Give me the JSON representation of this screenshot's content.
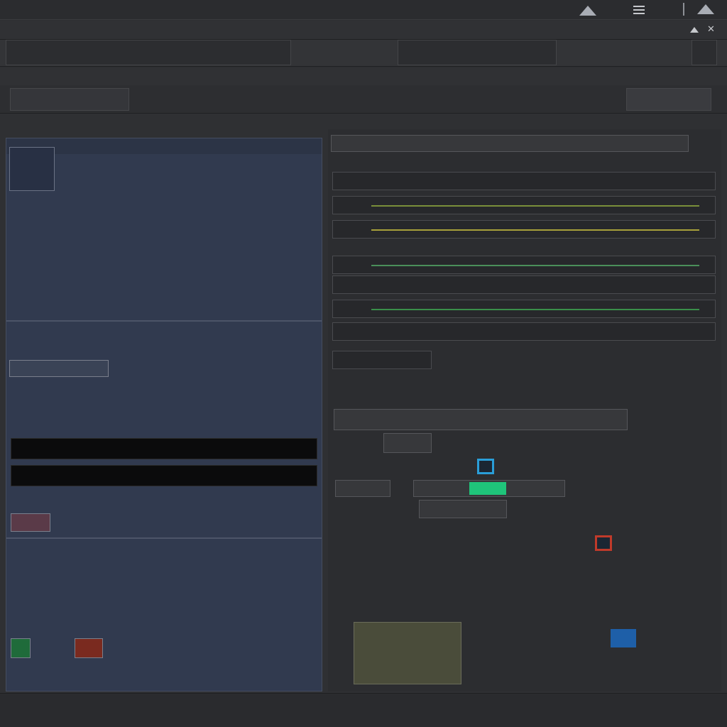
{
  "colors": {
    "app_background": "#2f3033",
    "left_panel": "#313a4f",
    "right_panel": "#2c2d30",
    "accent_green": "#1fc47a",
    "accent_blue": "#2a9ed8"
  },
  "icons": {
    "topbar": [
      "mountain-icon",
      "menu-icon",
      "minimize-icon",
      "maximize-icon"
    ],
    "window_controls": [
      "window-up-icon",
      "close-icon"
    ]
  },
  "topbar": {
    "title": "",
    "counter": ""
  },
  "menubar": {
    "left_text": "",
    "right_text": ""
  },
  "toolbar": {
    "group_1": "",
    "group_2": "",
    "group_3": "",
    "group_4": "",
    "right_text": ""
  },
  "substrip": {
    "text": ""
  },
  "tabs": [
    {
      "label": ""
    },
    {
      "label": ""
    },
    {
      "label": ""
    },
    {
      "label": ""
    },
    {
      "label": ""
    },
    {
      "label": ""
    }
  ],
  "section_bar": {
    "text": ""
  },
  "left_panel": {
    "header": "",
    "rows": [
      "",
      "",
      "",
      "",
      "",
      ""
    ],
    "secondary_rows": [
      "",
      "",
      "",
      "",
      ""
    ],
    "dark_rows": [
      "",
      ""
    ],
    "list_rows": [
      "",
      "",
      "",
      "",
      "",
      "",
      ""
    ],
    "footer": ""
  },
  "right_panel": {
    "header": "",
    "track_labels": [
      "",
      "",
      "",
      "",
      "",
      "",
      "",
      "",
      "",
      ""
    ],
    "chips": [
      "",
      "",
      "",
      "",
      "",
      ""
    ],
    "side_labels": [
      "",
      "",
      "",
      "",
      "",
      "",
      "",
      ""
    ],
    "art_label": ""
  },
  "statusbar": {
    "left": "",
    "middle": "",
    "right": ""
  }
}
